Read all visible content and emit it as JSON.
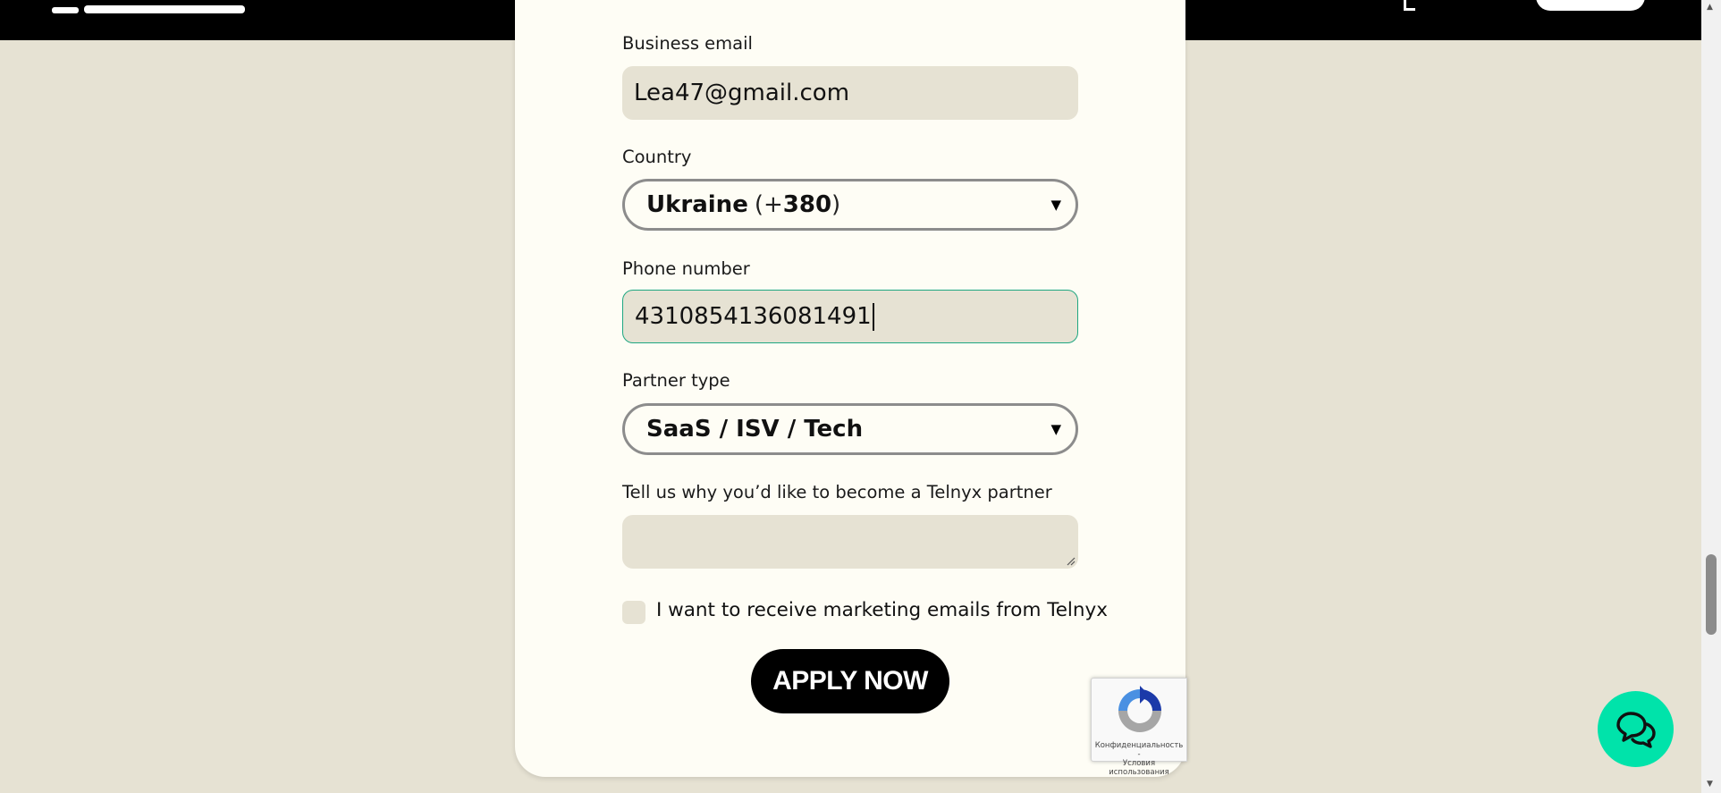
{
  "form": {
    "business_email_label": "Business email",
    "business_email_value": "Lea47@gmail.com",
    "country_label": "Country",
    "country_name": "Ukraine",
    "country_code_open": "(+",
    "country_code": "380",
    "country_code_close": ")",
    "phone_label": "Phone number",
    "phone_value": "4310854136081491",
    "partner_type_label": "Partner type",
    "partner_type_value": "SaaS / ISV / Tech",
    "reason_label": "Tell us why you’d like to become a Telnyx partner",
    "reason_value": "",
    "marketing_checkbox_label": "I want to receive marketing emails from Telnyx",
    "marketing_checked": false,
    "submit_label": "APPLY NOW"
  },
  "recaptcha": {
    "text_line1": "Конфиденциальность -",
    "text_line2": "Условия использования"
  },
  "icons": {
    "dropdown": "caret-down-icon",
    "chat": "chat-bubbles-icon",
    "recaptcha": "recaptcha-logo-icon"
  },
  "colors": {
    "page_background": "#e6e2d3",
    "card_background": "#fefdf5",
    "input_background": "#e6e2d3",
    "focus_border": "#1ea781",
    "chat_button": "#00e3aa",
    "primary_button": "#000000",
    "nav_background": "#000000"
  }
}
